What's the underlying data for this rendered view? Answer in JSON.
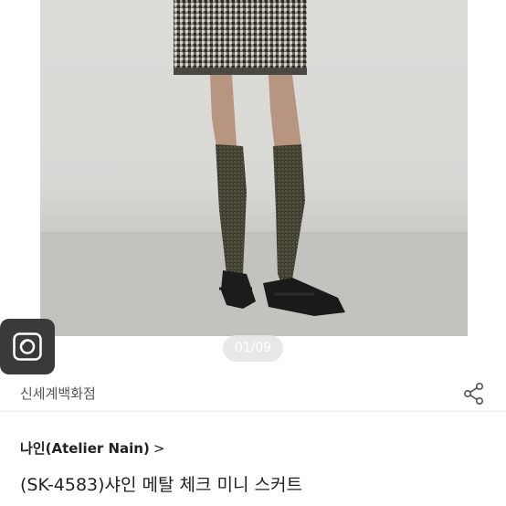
{
  "gallery": {
    "image_alt": "product photo",
    "counter": "01/09"
  },
  "icons": {
    "camera": "camera-icon",
    "share": "share-icon"
  },
  "store": {
    "name": "신세계백화점"
  },
  "product": {
    "brand": "나인(Atelier Nain)",
    "brand_chevron": ">",
    "title": "(SK-4583)샤인 메탈 체크 미니 스커트"
  },
  "colors": {
    "text_primary": "#222222",
    "text_secondary": "#555555",
    "camera_button_bg": "#3a3a3a"
  }
}
